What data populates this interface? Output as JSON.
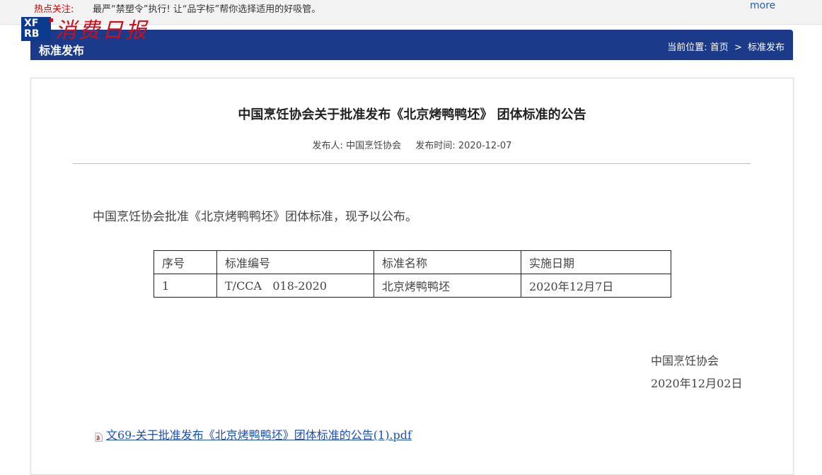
{
  "ticker": {
    "label": "热点关注:",
    "text": "最严“禁塑令”执行! 让“品字标”帮你选择适用的好吸管。",
    "more": "more"
  },
  "logo": {
    "box_line1": "XF",
    "box_line2": "RB",
    "script": "消费日报"
  },
  "navbar": {
    "title": "标准发布",
    "breadcrumb_prefix": "当前位置:",
    "breadcrumb_home": "首页",
    "breadcrumb_sep": ">",
    "breadcrumb_current": "标准发布"
  },
  "article": {
    "title": "中国烹饪协会关于批准发布《北京烤鸭鸭坯》 团体标准的公告",
    "publisher_label": "发布人:",
    "publisher": "中国烹饪协会",
    "date_label": "发布时间:",
    "date": "2020-12-07",
    "body": "中国烹饪协会批准《北京烤鸭鸭坯》团体标准，现予以公布。",
    "table": {
      "headers": [
        "序号",
        "标准编号",
        "标准名称",
        "实施日期"
      ],
      "rows": [
        [
          "1",
          "T/CCA   018-2020",
          "北京烤鸭鸭坯",
          "2020年12月7日"
        ]
      ]
    },
    "sign_org": "中国烹饪协会",
    "sign_date": "2020年12月02日",
    "attachment": "文69-关于批准发布《北京烤鸭鸭坯》团体标准的公告(1).pdf"
  },
  "colors": {
    "navbar": "#1b3a8a",
    "ticker_label": "#d40000",
    "link": "#1a4fbf",
    "logo_red": "#c8101e"
  }
}
